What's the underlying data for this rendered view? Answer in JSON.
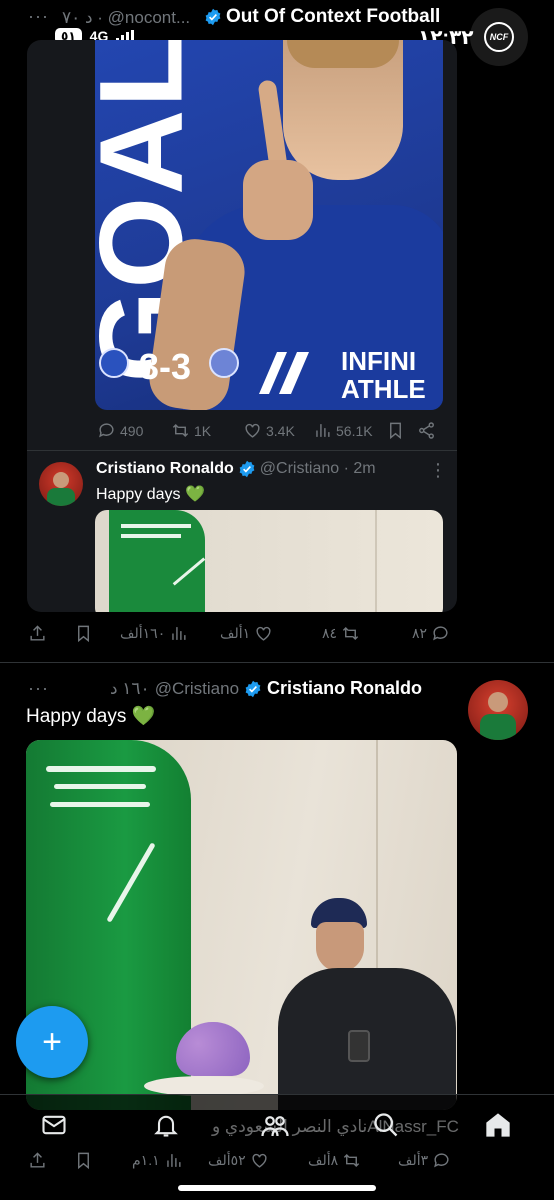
{
  "status_bar": {
    "time": "١٢:٣٢",
    "network": "4G",
    "battery": "٥١"
  },
  "top_tweet": {
    "author_name": "Out Of Context Football",
    "handle_time": "د ٧٠ · @nocont...",
    "more": "···",
    "avatar_text": "NCF",
    "graphic_big_text": "GOAL",
    "graphic_score": "3-3",
    "graphic_sponsor_line1": "INFINI",
    "graphic_sponsor_line2": "ATHLE",
    "metrics": {
      "replies": "490",
      "retweets": "1K",
      "likes": "3.4K",
      "views": "56.1K"
    },
    "quoted": {
      "author_name": "Cristiano Ronaldo",
      "handle_time": "@Cristiano · 2m",
      "text": "Happy days 💚",
      "more": "⋮"
    }
  },
  "top_tweet_actions": {
    "replies": "٨٢",
    "retweets": "٨٤",
    "likes": "١ألف",
    "views": "١٦٠ألف"
  },
  "main_tweet": {
    "author_name": "Cristiano Ronaldo",
    "handle": "@Cristiano",
    "time": "١٦٠ د",
    "more": "···",
    "text": "Happy days 💚",
    "caption": "نادي النصر السعودي وAlNassr_FC",
    "actions": {
      "replies": "٣ألف",
      "retweets": "٨ألف",
      "likes": "٥٢ألف",
      "views": "١.١م"
    }
  },
  "fab": {
    "symbol": "+"
  },
  "bottom_nav": [
    "home-icon",
    "search-icon",
    "communities-icon",
    "notifications-icon",
    "messages-icon"
  ],
  "colors": {
    "background": "#000000",
    "card": "#16181c",
    "accent": "#1d9bf0",
    "verified": "#1d9bf0",
    "chelsea_blue": "#1f3f9a",
    "flag_green": "#1a8a3c"
  }
}
